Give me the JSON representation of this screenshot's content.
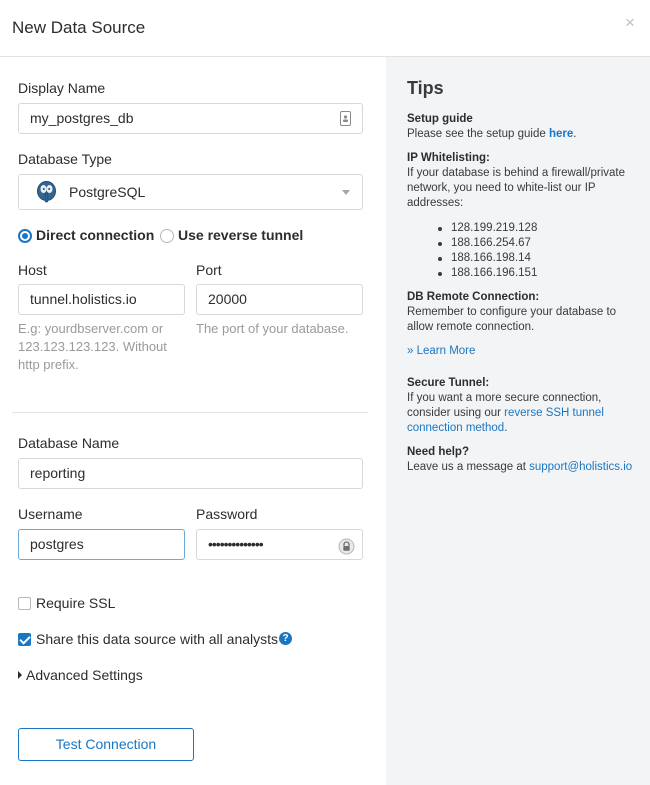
{
  "dialog": {
    "title": "New Data Source",
    "close_glyph": "×"
  },
  "form": {
    "display_name": {
      "label": "Display Name",
      "value": "my_postgres_db"
    },
    "database_type": {
      "label": "Database Type",
      "value": "PostgreSQL",
      "icon": "postgresql-elephant-icon"
    },
    "connection": {
      "direct_label": "Direct connection",
      "reverse_label": "Use reverse tunnel",
      "selected": "direct"
    },
    "host": {
      "label": "Host",
      "value": "tunnel.holistics.io",
      "help": "E.g: yourdbserver.com or 123.123.123.123. Without http prefix."
    },
    "port": {
      "label": "Port",
      "value": "20000",
      "help": "The port of your database."
    },
    "database_name": {
      "label": "Database Name",
      "value": "reporting"
    },
    "username": {
      "label": "Username",
      "value": "postgres"
    },
    "password": {
      "label": "Password",
      "value": "••••••••••••••"
    },
    "require_ssl": {
      "label": "Require SSL",
      "checked": false
    },
    "share": {
      "label": "Share this data source with all analysts",
      "checked": true
    },
    "advanced": {
      "label": "Advanced Settings"
    },
    "test_button": "Test Connection"
  },
  "tips": {
    "title": "Tips",
    "setup_guide": {
      "heading": "Setup guide",
      "text": "Please see the setup guide ",
      "link": "here",
      "end": "."
    },
    "ip_whitelisting": {
      "heading": "IP Whitelisting:",
      "text": "If your database is behind a firewall/private network, you need to white-list our IP addresses:",
      "ips": [
        "128.199.219.128",
        "188.166.254.67",
        "188.166.198.14",
        "188.166.196.151"
      ]
    },
    "db_remote": {
      "heading": "DB Remote Connection:",
      "text": "Remember to configure your database to allow remote connection."
    },
    "learn_more": "» Learn More",
    "secure_tunnel": {
      "heading": "Secure Tunnel:",
      "text": "If you want a more secure connection, consider using our ",
      "link": "reverse SSH tunnel connection method",
      "end": "."
    },
    "need_help": {
      "heading": "Need help?",
      "text": "Leave us a message at ",
      "email": "support@holistics.io"
    }
  },
  "colors": {
    "accent": "#1b76c2",
    "panel_bg": "#f3f4f6",
    "border": "#d8d8d8"
  }
}
